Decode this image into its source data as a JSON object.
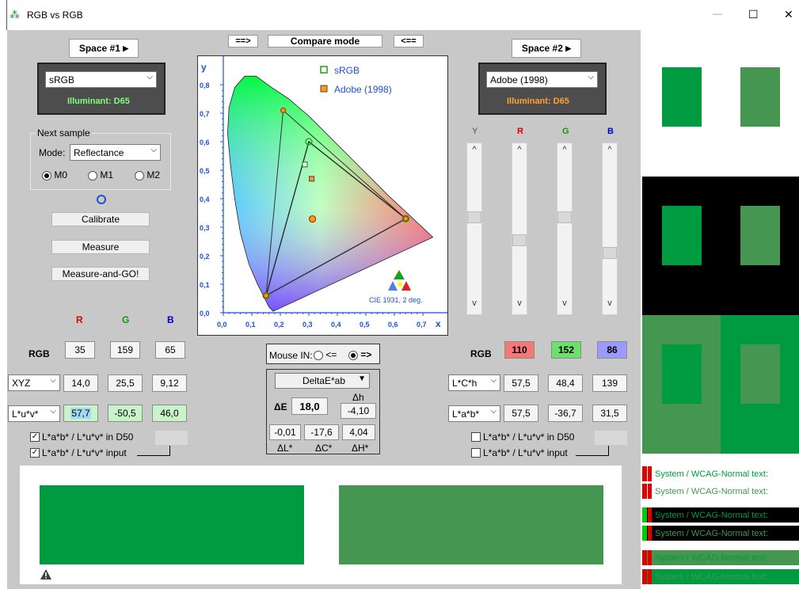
{
  "window": {
    "title": "RGB vs RGB",
    "minimize": "—",
    "maximize": "☐",
    "close": "✕"
  },
  "space1": {
    "button": "Space #1",
    "profile": "sRGB",
    "illuminant": "Illuminant: D65"
  },
  "space2": {
    "button": "Space #2",
    "profile": "Adobe (1998)",
    "illuminant": "Illuminant: D65"
  },
  "compare": {
    "left_arrow": "==>",
    "label": "Compare mode",
    "right_arrow": "<=="
  },
  "sample": {
    "legend": "Next sample",
    "mode_label": "Mode:",
    "mode_value": "Reflectance",
    "m0": "M0",
    "m1": "M1",
    "m2": "M2",
    "calibrate": "Calibrate",
    "measure": "Measure",
    "measure_go": "Measure-and-GO!"
  },
  "chart": {
    "y_label": "y",
    "x_label": "x",
    "legend": [
      "sRGB",
      "Adobe (1998)"
    ],
    "caption": "CIE 1931, 2 deg.",
    "y_ticks": [
      "0,8",
      "0,7",
      "0,6",
      "0,5",
      "0,4",
      "0,3",
      "0,2",
      "0,1",
      "0,0"
    ],
    "x_ticks": [
      "0,0",
      "0,1",
      "0,2",
      "0,3",
      "0,4",
      "0,5",
      "0,6",
      "0,7"
    ]
  },
  "chart_data": {
    "type": "scatter",
    "title": "",
    "xlabel": "x",
    "ylabel": "y",
    "xlim": [
      0,
      0.8
    ],
    "ylim": [
      0,
      0.9
    ],
    "series": [
      {
        "name": "sRGB",
        "values": [
          [
            0.64,
            0.33
          ],
          [
            0.3,
            0.6
          ],
          [
            0.15,
            0.06
          ]
        ],
        "white": [
          0.3127,
          0.329
        ],
        "sample": [
          0.286,
          0.52
        ]
      },
      {
        "name": "Adobe (1998)",
        "values": [
          [
            0.64,
            0.33
          ],
          [
            0.21,
            0.71
          ],
          [
            0.15,
            0.06
          ]
        ],
        "white": [
          0.3127,
          0.329
        ],
        "sample": [
          0.31,
          0.47
        ]
      }
    ]
  },
  "left": {
    "headers": {
      "r": "R",
      "g": "G",
      "b": "B"
    },
    "rgb_label": "RGB",
    "rgb": [
      "35",
      "159",
      "65"
    ],
    "xyz_label": "XYZ",
    "xyz": [
      "14,0",
      "25,5",
      "9,12"
    ],
    "luv_label": "L*u*v*",
    "luv": [
      "57,7",
      "-50,5",
      "46,0"
    ],
    "check1": "L*a*b* / L*u*v* in D50",
    "check2": "L*a*b* / L*u*v* input"
  },
  "right": {
    "rgb_label": "RGB",
    "rgb": [
      "110",
      "152",
      "86"
    ],
    "lch_label": "L*C*h",
    "lch": [
      "57,5",
      "48,4",
      "139"
    ],
    "lab_label": "L*a*b*",
    "lab": [
      "57,5",
      "-36,7",
      "31,5"
    ],
    "check1": "L*a*b* / L*u*v* in D50",
    "check2": "L*a*b* / L*u*v* input",
    "sliders": {
      "y": "Y",
      "r": "R",
      "g": "G",
      "b": "B"
    }
  },
  "mouse": {
    "label": "Mouse IN:",
    "left": "<=",
    "right": "=>"
  },
  "delta": {
    "method": "DeltaE*ab",
    "de_label": "ΔE",
    "de": "18,0",
    "dh_label": "Δh",
    "dh": "-4,10",
    "dl": "-0,01",
    "dc": "-17,6",
    "dH": "4,04",
    "dl_label": "ΔL*",
    "dc_label": "ΔC*",
    "dH_label": "ΔH*"
  },
  "colors": {
    "left": "#009B40",
    "right": "#449650",
    "red_col": "#e00000",
    "green_col": "#0aa000",
    "blue_col": "#0000d0"
  },
  "wcag": {
    "text": "System / WCAG-Normal text:"
  }
}
